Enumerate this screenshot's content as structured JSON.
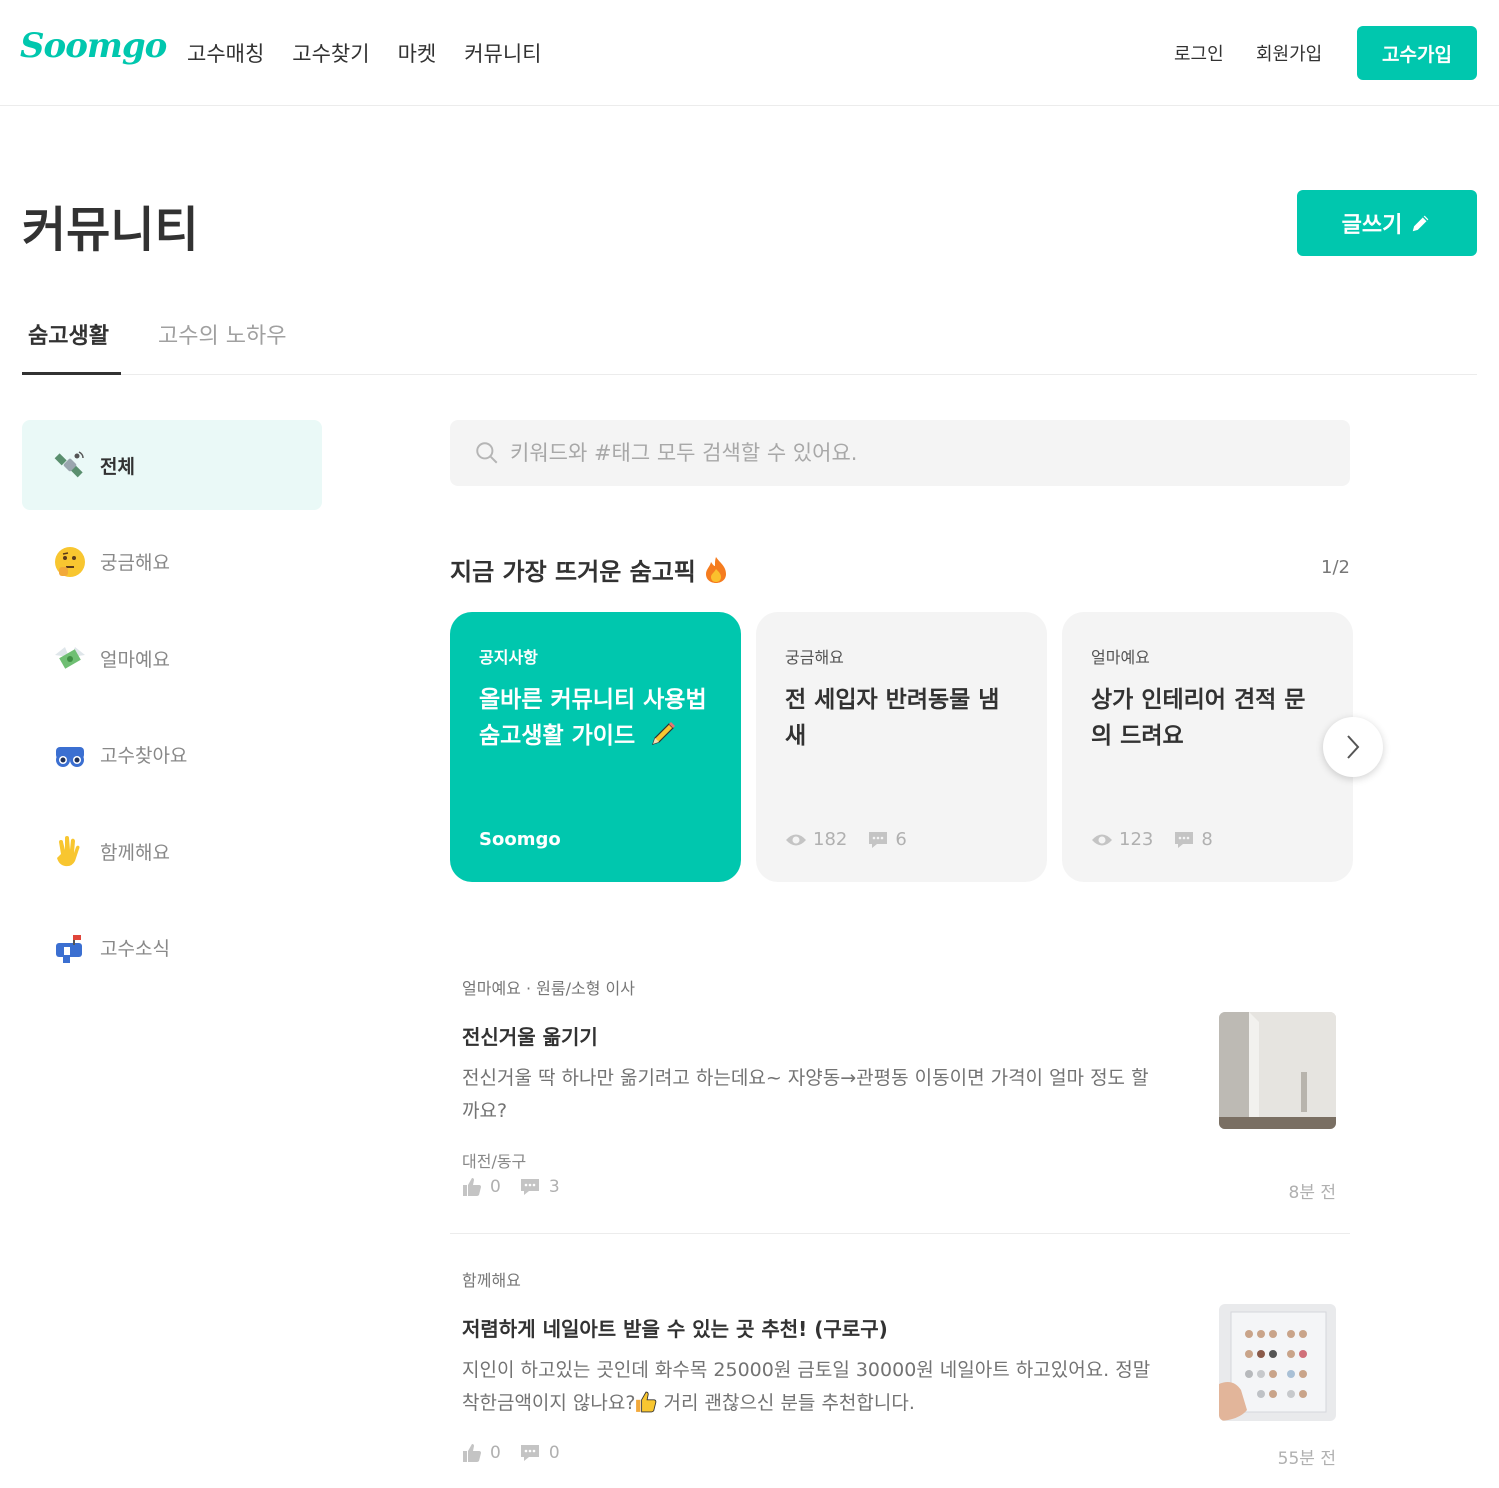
{
  "header": {
    "logo": "Soomgo",
    "nav": [
      "고수매칭",
      "고수찾기",
      "마켓",
      "커뮤니티"
    ],
    "login": "로그인",
    "signup": "회원가입",
    "pro_signup": "고수가입"
  },
  "page": {
    "title": "커뮤니티",
    "write_button": "글쓰기"
  },
  "tabs": [
    "숨고생활",
    "고수의 노하우"
  ],
  "sidebar": {
    "items": [
      {
        "label": "전체",
        "icon": "satellite-icon",
        "active": true
      },
      {
        "label": "궁금해요",
        "icon": "thinking-face-icon",
        "active": false
      },
      {
        "label": "얼마예요",
        "icon": "money-wings-icon",
        "active": false
      },
      {
        "label": "고수찾아요",
        "icon": "binoculars-icon",
        "active": false
      },
      {
        "label": "함께해요",
        "icon": "waving-hand-icon",
        "active": false
      },
      {
        "label": "고수소식",
        "icon": "mailbox-icon",
        "active": false
      }
    ]
  },
  "search": {
    "placeholder": "키워드와 #태그 모두 검색할 수 있어요."
  },
  "hot": {
    "title": "지금 가장 뜨거운 숨고픽",
    "page": "1/2",
    "cards": [
      {
        "category": "공지사항",
        "title_line1": "올바른 커뮤니티 사용법",
        "title_line2": "숨고생활 가이드",
        "footer": "Soomgo"
      },
      {
        "category": "궁금해요",
        "title_line1": "전 세입자 반려동물 냄",
        "title_line2": "새",
        "views": "182",
        "comments": "6"
      },
      {
        "category": "얼마예요",
        "title_line1": "상가 인테리어 견적 문",
        "title_line2": "의 드려요",
        "views": "123",
        "comments": "8"
      }
    ]
  },
  "posts": [
    {
      "category": "얼마예요 · 원룸/소형 이사",
      "title": "전신거울 옮기기",
      "body_line1": "전신거울 딱 하나만 옮기려고 하는데요~ 자양동→관평동 이동이면 가격이 얼마 정도 할",
      "body_line2": "까요?",
      "location": "대전/동구",
      "likes": "0",
      "comments": "3",
      "time": "8분 전"
    },
    {
      "category": "함께해요",
      "title": "저렴하게 네일아트 받을 수 있는 곳 추천! (구로구)",
      "body_line1": "지인이 하고있는 곳인데 화수목 25000원 금토일 30000원 네일아트 하고있어요. 정말",
      "body_line2a": "착한금액이지 않나요?",
      "body_line2b": " 거리 괜찮으신 분들 추천합니다.",
      "likes": "0",
      "comments": "0",
      "time": "55분 전"
    }
  ],
  "colors": {
    "brand": "#00c7ae",
    "active_bg": "#eaf9f7"
  }
}
